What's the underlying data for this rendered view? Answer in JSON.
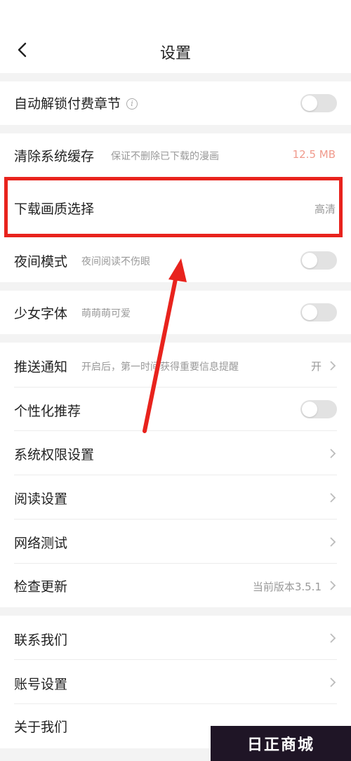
{
  "header": {
    "title": "设置"
  },
  "rows": {
    "auto_unlock": {
      "label": "自动解锁付费章节",
      "toggle_on": false
    },
    "clear_cache": {
      "label": "清除系统缓存",
      "desc": "保证不删除已下载的漫画",
      "value": "12.5 MB"
    },
    "download_quality": {
      "label": "下载画质选择",
      "value": "高清"
    },
    "night_mode": {
      "label": "夜间模式",
      "desc": "夜间阅读不伤眼",
      "toggle_on": false
    },
    "girl_font": {
      "label": "少女字体",
      "desc": "萌萌萌可爱",
      "toggle_on": false
    },
    "push": {
      "label": "推送通知",
      "desc": "开启后，第一时间获得重要信息提醒",
      "value": "开"
    },
    "personalized": {
      "label": "个性化推荐",
      "toggle_on": false
    },
    "permissions": {
      "label": "系统权限设置"
    },
    "reading": {
      "label": "阅读设置"
    },
    "network": {
      "label": "网络测试"
    },
    "update": {
      "label": "检查更新",
      "value": "当前版本3.5.1"
    },
    "contact": {
      "label": "联系我们"
    },
    "account": {
      "label": "账号设置"
    },
    "about": {
      "label": "关于我们"
    }
  },
  "watermark": {
    "text": "日正商城"
  },
  "colors": {
    "highlight": "#e8231d",
    "arrow": "#e8231d",
    "cache_value": "#f09a8c",
    "toggle_off": "#e2e2e2"
  }
}
